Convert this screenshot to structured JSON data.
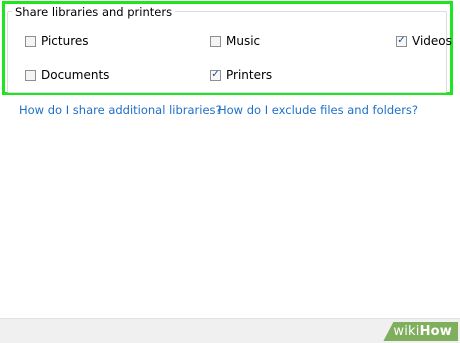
{
  "group": {
    "title": "Share libraries and printers",
    "options": [
      {
        "label": "Pictures",
        "checked": false
      },
      {
        "label": "Music",
        "checked": false
      },
      {
        "label": "Videos",
        "checked": true
      },
      {
        "label": "Documents",
        "checked": false
      },
      {
        "label": "Printers",
        "checked": true
      }
    ]
  },
  "links": {
    "share_libraries": "How do I share additional libraries?",
    "exclude_files": "How do I exclude files and folders?"
  },
  "watermark": {
    "prefix": "wiki",
    "suffix": "How"
  },
  "colors": {
    "highlight": "#1fe51f",
    "link": "#1e6fc8",
    "watermark": "#7fae5c"
  },
  "icons": {
    "checkmark": "checkmark-icon"
  }
}
